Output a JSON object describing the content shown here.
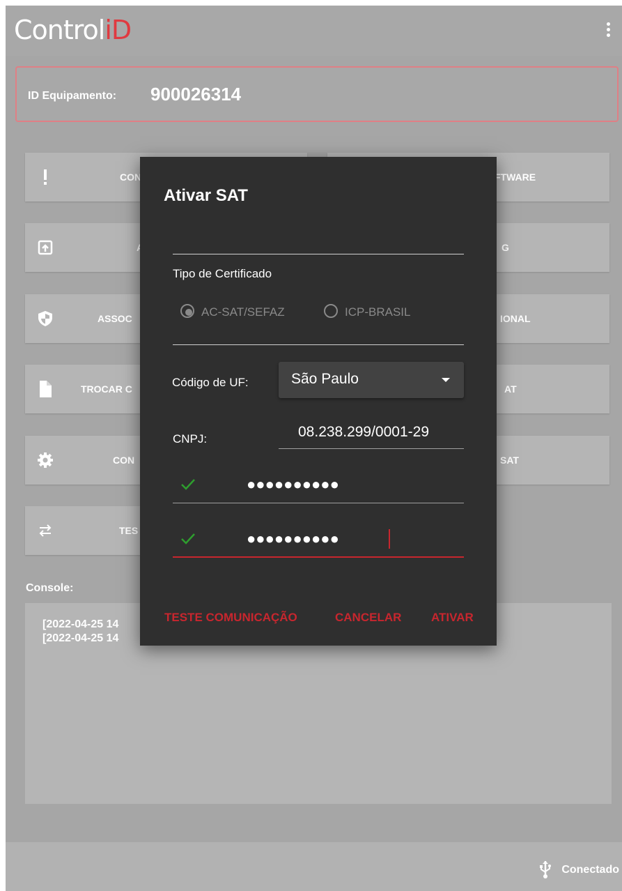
{
  "app": {
    "logo_text": "Control",
    "logo_accent": "iD",
    "menu_icon": "kebab-menu-icon"
  },
  "device": {
    "label": "ID Equipamento:",
    "value": "900026314"
  },
  "menu_buttons": [
    {
      "id": "row1-left",
      "icon": "exclamation-icon",
      "label": "CON"
    },
    {
      "id": "row1-right",
      "icon": "",
      "label": "FTWARE"
    },
    {
      "id": "row2-left",
      "icon": "upload-icon",
      "label": "A"
    },
    {
      "id": "row2-right",
      "icon": "",
      "label": "G"
    },
    {
      "id": "row3-left",
      "icon": "shield-icon",
      "label": "ASSOC"
    },
    {
      "id": "row3-right",
      "icon": "",
      "label": "IONAL"
    },
    {
      "id": "row4-left",
      "icon": "file-icon",
      "label": "TROCAR C"
    },
    {
      "id": "row4-right",
      "icon": "",
      "label": "AT"
    },
    {
      "id": "row5-left",
      "icon": "gear-icon",
      "label": "CON"
    },
    {
      "id": "row5-right",
      "icon": "",
      "label": "SAT"
    },
    {
      "id": "row6-left",
      "icon": "swap-arrows-icon",
      "label": "TES"
    }
  ],
  "console": {
    "label": "Console:",
    "lines": [
      "[2022-04-25 14",
      "[2022-04-25 14"
    ]
  },
  "footer": {
    "status_icon": "usb-icon",
    "status_text": "Conectado"
  },
  "dialog": {
    "title": "Ativar SAT",
    "cert_label": "Tipo de Certificado",
    "cert_options": [
      {
        "label": "AC-SAT/SEFAZ",
        "selected": true
      },
      {
        "label": "ICP-BRASIL",
        "selected": false
      }
    ],
    "uf_label": "Código de UF:",
    "uf_value": "São Paulo",
    "cnpj_label": "CNPJ:",
    "cnpj_value": "08.238.299/0001-29",
    "password_mask": "●●●●●●●●●●",
    "confirm_mask": "●●●●●●●●●●",
    "buttons": {
      "test": "TESTE COMUNICAÇÃO",
      "cancel": "CANCELAR",
      "activate": "ATIVAR"
    }
  },
  "colors": {
    "accent": "#c8262e",
    "check": "#2e9e2e",
    "dialog_bg": "#2f2f2f"
  }
}
